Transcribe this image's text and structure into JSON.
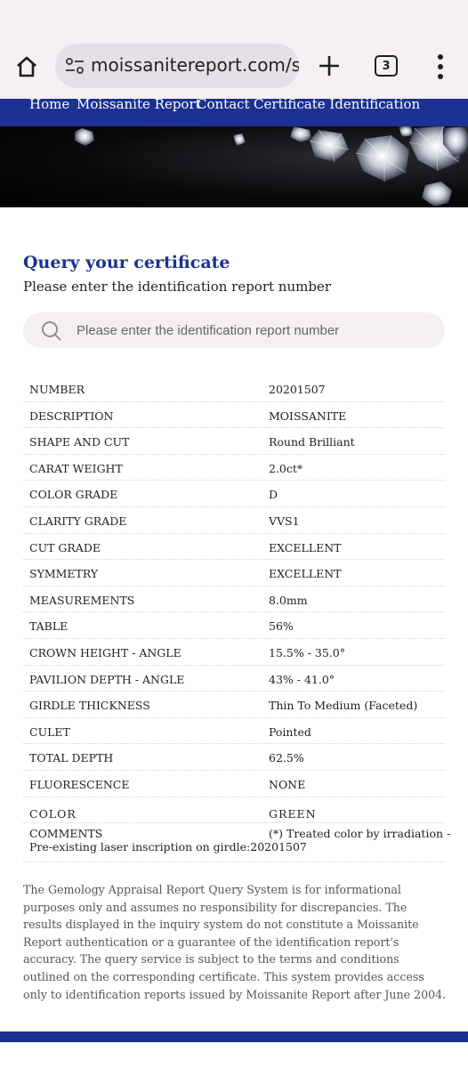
{
  "browser": {
    "url": "moissanitereport.com/se",
    "tab_count": "3",
    "icons": [
      "home-icon",
      "site-settings-icon",
      "new-tab-plus-icon",
      "tab-switcher-icon",
      "more-vert-icon"
    ]
  },
  "nav": {
    "items": [
      "Home",
      "Moissanite Report",
      "Contact",
      "Certificate Identification"
    ]
  },
  "page": {
    "title": "Query your certificate",
    "subtitle": "Please enter the identification report number"
  },
  "search": {
    "placeholder": "Please enter the identification report number",
    "value": ""
  },
  "report": {
    "rows": [
      {
        "label": "NUMBER",
        "value": "20201507"
      },
      {
        "label": "DESCRIPTION",
        "value": "MOISSANITE"
      },
      {
        "label": "SHAPE AND CUT",
        "value": "Round Brilliant"
      },
      {
        "label": "CARAT WEIGHT",
        "value": "2.0ct*"
      },
      {
        "label": "COLOR GRADE",
        "value": "D"
      },
      {
        "label": "CLARITY GRADE",
        "value": "VVS1"
      },
      {
        "label": "CUT GRADE",
        "value": "EXCELLENT"
      },
      {
        "label": "SYMMETRY",
        "value": "EXCELLENT"
      },
      {
        "label": "MEASUREMENTS",
        "value": "8.0mm"
      },
      {
        "label": "TABLE",
        "value": "56%"
      },
      {
        "label": "CROWN HEIGHT - ANGLE",
        "value": "15.5% - 35.0°"
      },
      {
        "label": "PAVILION DEPTH - ANGLE",
        "value": "43% - 41.0°"
      },
      {
        "label": "GIRDLE THICKNESS",
        "value": "Thin To Medium (Faceted)"
      },
      {
        "label": "CULET",
        "value": "Pointed"
      },
      {
        "label": "TOTAL DEPTH",
        "value": "62.5%"
      },
      {
        "label": "FLUORESCENCE",
        "value": "NONE"
      },
      {
        "label": "COLOR",
        "value": "GREEN"
      }
    ],
    "comments": {
      "label": "COMMENTS",
      "value": "(*) Treated color by irradiation -",
      "continuation": "Pre-existing laser inscription on girdle:20201507"
    }
  },
  "disclaimer": "The Gemology Appraisal Report Query System is for informational purposes only and assumes no responsibility for discrepancies. The results displayed in the inquiry system do not constitute a Moissanite Report authentication or a guarantee of the identification report's accuracy. The query service is subject to the terms and conditions outlined on the corresponding certificate. This system provides access only to identification reports issued by Moissanite Report after June 2004.",
  "colors": {
    "brand_blue": "#1c3191",
    "chrome_bg": "#f4f0f4",
    "urlbar_bg": "#e6e0e6"
  }
}
